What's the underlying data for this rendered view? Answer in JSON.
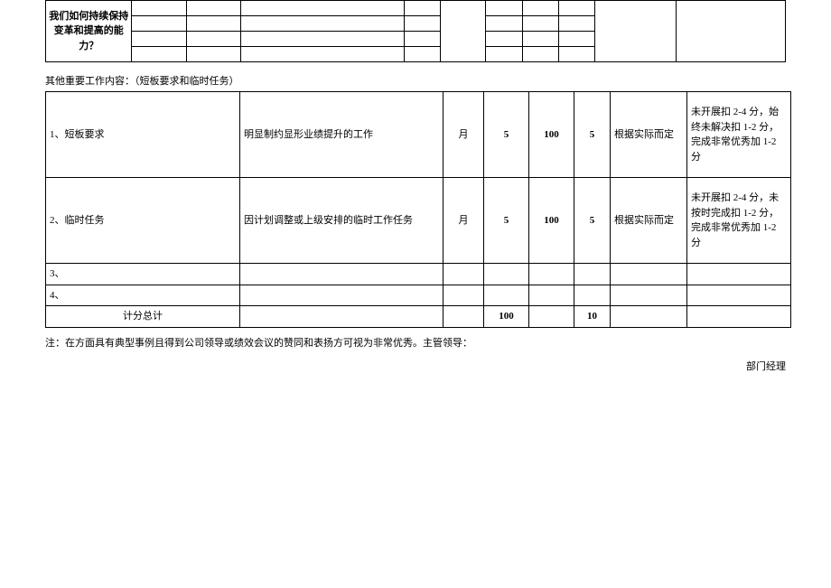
{
  "top_table": {
    "rowspan_text": "我们如何持续保持变革和提高的能力？"
  },
  "section_title": "其他重要工作内容：（短板要求和临时任务）",
  "rows": [
    {
      "label": "1、短板要求",
      "desc": "明显制约显形业绩提升的工作",
      "period": "月",
      "weight": "5",
      "base": "100",
      "score": "5",
      "basis": "根据实际而定",
      "rule": "未开展扣 2-4 分，始终未解决扣 1-2 分，完成非常优秀加 1-2 分"
    },
    {
      "label": "2、临时任务",
      "desc": "因计划调整或上级安排的临时工作任务",
      "period": "月",
      "weight": "5",
      "base": "100",
      "score": "5",
      "basis": "根据实际而定",
      "rule": "未开展扣 2-4 分，未按时完成扣 1-2 分，完成非常优秀加 1-2 分"
    }
  ],
  "row3_label": "3、",
  "row4_label": "4、",
  "total": {
    "label": "计分总计",
    "weight": "100",
    "score": "10"
  },
  "footnote": "注：在方面具有典型事例且得到公司领导或绩效会议的赞同和表扬方可视为非常优秀。主管领导：",
  "signature": "部门经理"
}
